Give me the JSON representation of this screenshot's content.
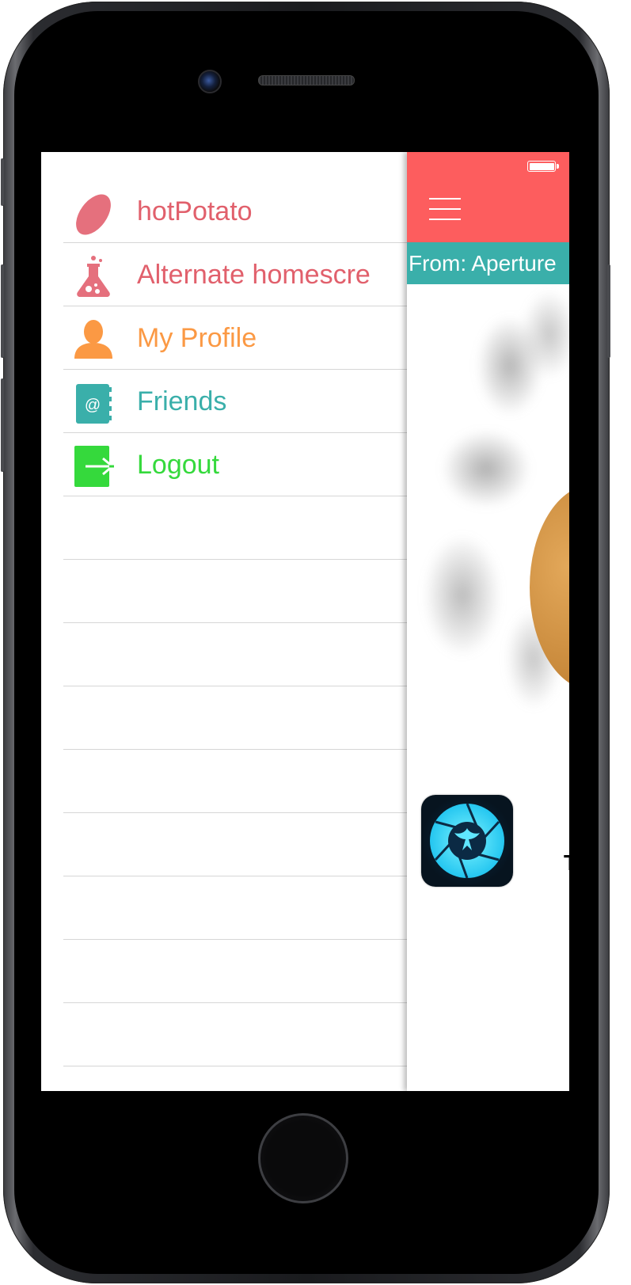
{
  "menu": {
    "items": [
      {
        "label": "hotPotato",
        "icon": "potato-icon",
        "color": "#e1606c"
      },
      {
        "label": "Alternate homescre",
        "icon": "flask-icon",
        "color": "#e1606c"
      },
      {
        "label": "My Profile",
        "icon": "person-icon",
        "color": "#fb9944"
      },
      {
        "label": "Friends",
        "icon": "address-book-icon",
        "color": "#3aafaa"
      },
      {
        "label": "Logout",
        "icon": "logout-icon",
        "color": "#35d93c"
      }
    ]
  },
  "main": {
    "navbar_color": "#fd5d5e",
    "from_text": "From: Aperture",
    "cut_text": "T",
    "app_icon": "aperture-phoenix-icon"
  },
  "address_book_glyph": "@"
}
